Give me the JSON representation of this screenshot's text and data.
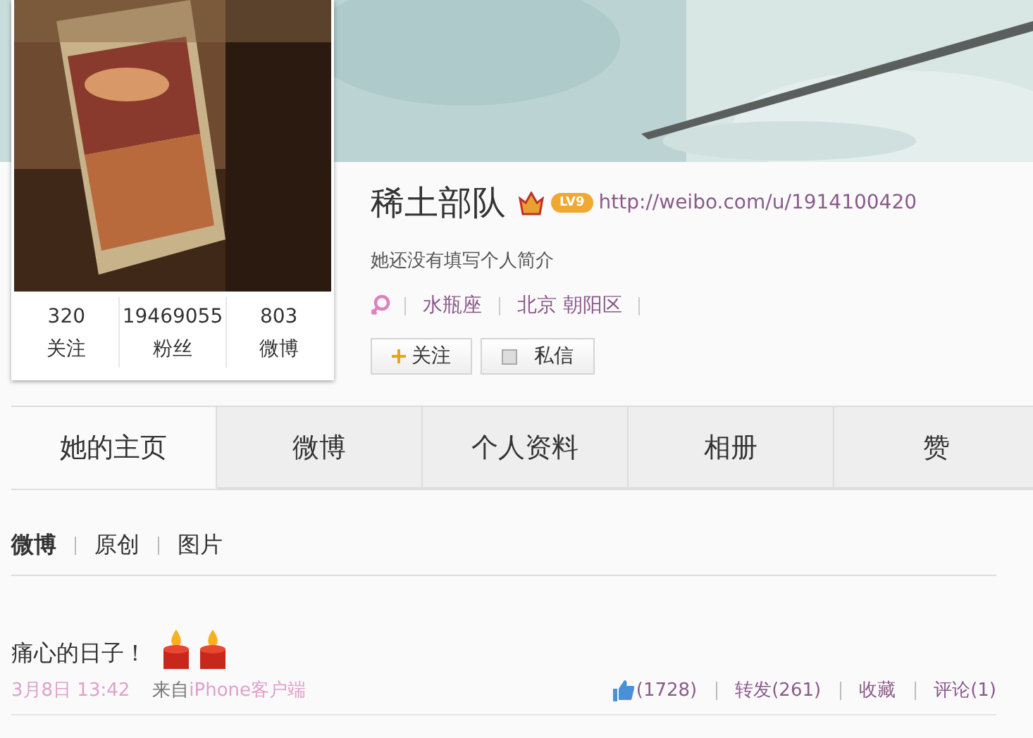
{
  "cover": {
    "kind": "picture"
  },
  "profile": {
    "avatar": {
      "kind": "picture"
    },
    "stats": [
      {
        "value": "320",
        "label": "关注"
      },
      {
        "value": "19469055",
        "label": "粉丝"
      },
      {
        "value": "803",
        "label": "微博"
      }
    ],
    "name": "稀土部队",
    "level": "LV9",
    "url": "http://weibo.com/u/1914100420",
    "bio": "她还没有填写个人简介",
    "tags": [
      "水瓶座",
      "北京 朝阳区"
    ],
    "buttons": [
      {
        "kind": "follow",
        "label": "关注"
      },
      {
        "kind": "message",
        "label": "私信"
      }
    ]
  },
  "tabs": [
    {
      "label": "她的主页",
      "selected": true
    },
    {
      "label": "微博",
      "selected": false
    },
    {
      "label": "个人资料",
      "selected": false
    },
    {
      "label": "相册",
      "selected": false
    },
    {
      "label": "赞",
      "selected": false
    }
  ],
  "feed": {
    "filters": [
      {
        "label": "微博",
        "selected": true
      },
      {
        "label": "原创",
        "selected": false
      },
      {
        "label": "图片",
        "selected": false
      }
    ],
    "posts": [
      {
        "text": "痛心的日子！",
        "time": "3月8日 13:42",
        "source_prefix": "来自",
        "source": "iPhone客户端",
        "actions": [
          {
            "kind": "like",
            "label": "(1728)"
          },
          {
            "kind": "repost",
            "label": "转发(261)"
          },
          {
            "kind": "favorite",
            "label": "收藏"
          },
          {
            "kind": "comment",
            "label": "评论(1)"
          }
        ]
      }
    ]
  }
}
